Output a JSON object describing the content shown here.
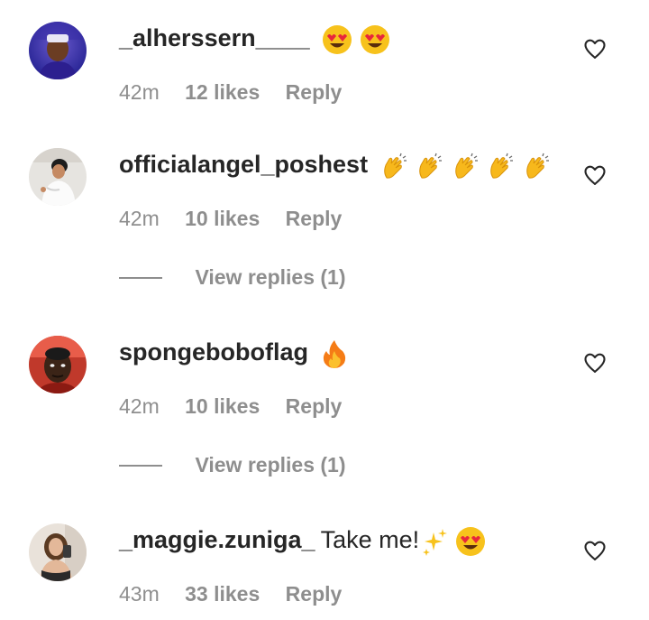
{
  "comments": [
    {
      "username": "_alherssern____",
      "text": "",
      "emoji_icons": [
        "heart-eyes-emoji",
        "heart-eyes-emoji"
      ],
      "time": "42m",
      "likes": "12 likes",
      "reply": "Reply",
      "view_replies": ""
    },
    {
      "username": "officialangel_poshest",
      "text": "",
      "emoji_icons": [
        "clapping-hands-emoji",
        "clapping-hands-emoji",
        "clapping-hands-emoji",
        "clapping-hands-emoji",
        "clapping-hands-emoji"
      ],
      "time": "42m",
      "likes": "10 likes",
      "reply": "Reply",
      "view_replies": "View replies (1)"
    },
    {
      "username": "spongeboboflag",
      "text": "",
      "emoji_icons": [
        "fire-emoji"
      ],
      "time": "42m",
      "likes": "10 likes",
      "reply": "Reply",
      "view_replies": "View replies (1)"
    },
    {
      "username": "_maggie.zuniga_",
      "text": "Take me!",
      "emoji_icons": [
        "sparkles-emoji",
        "heart-eyes-emoji"
      ],
      "time": "43m",
      "likes": "33 likes",
      "reply": "Reply",
      "view_replies": ""
    }
  ],
  "colors": {
    "text": "#262626",
    "secondary": "#8e8e8e",
    "emoji_yellow": "#f7c21c"
  }
}
